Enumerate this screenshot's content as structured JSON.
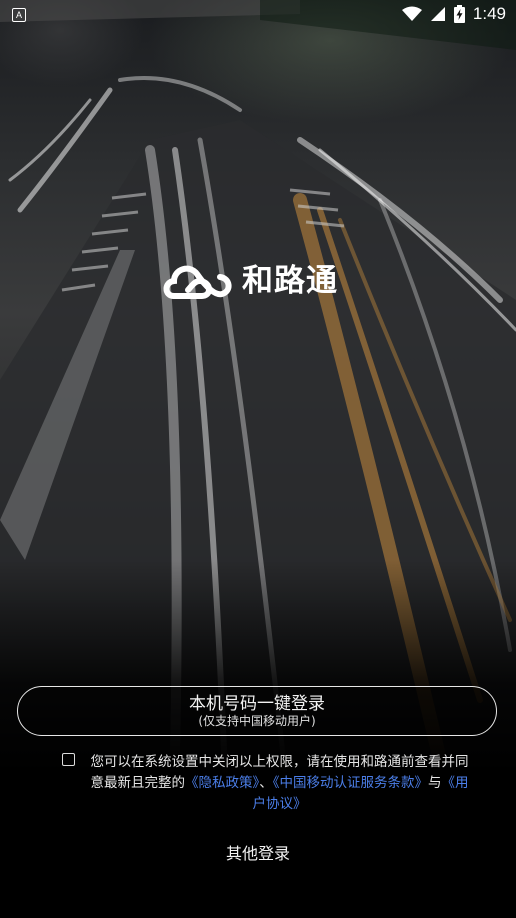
{
  "status_bar": {
    "notification_badge": "A",
    "time": "1:49",
    "icons": [
      "wifi-icon",
      "cell-signal-icon",
      "battery-charging-icon"
    ]
  },
  "logo": {
    "text": "和路通",
    "icon": "cloud-loop-logo-icon"
  },
  "login": {
    "primary_label": "本机号码一键登录",
    "secondary_label": "(仅支持中国移动用户)"
  },
  "agreement": {
    "checked": false,
    "text_before": "您可以在系统设置中关闭以上权限，请在使用和路通前查看并同意最新且完整的",
    "privacy_link": "《隐私政策》",
    "separator": "、",
    "cmcc_link": "《中国移动认证服务条款》",
    "conjunction": "与",
    "user_agreement_link": "《用户协议》",
    "link_color": "#4b7ee8"
  },
  "other_login": {
    "label": "其他登录"
  }
}
